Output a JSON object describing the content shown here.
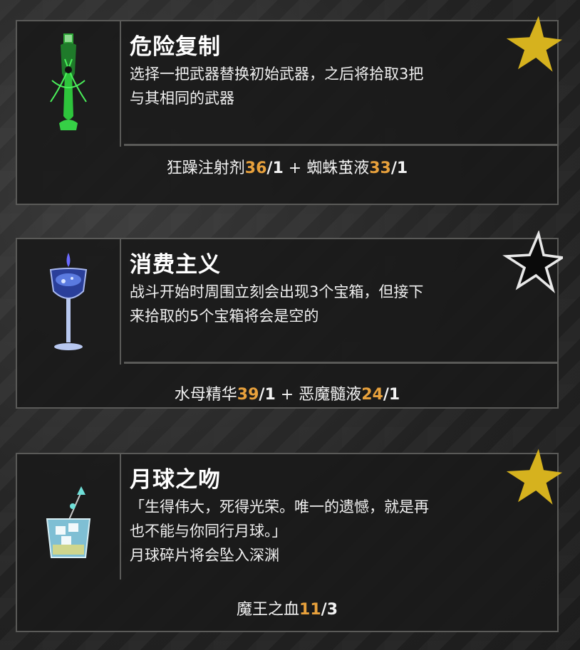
{
  "cards": [
    {
      "title": "危险复制",
      "desc": [
        "选择一把武器替换初始武器，之后将拾取3把",
        "与其相同的武器"
      ],
      "star": "gold-star",
      "recipe": [
        {
          "name": "狂躁注射剂",
          "have": "36",
          "need": "1"
        },
        {
          "sep": " + "
        },
        {
          "name": "蜘蛛茧液",
          "have": "33",
          "need": "1"
        }
      ],
      "icon": "green-potion-vial-icon"
    },
    {
      "title": "消费主义",
      "desc": [
        "战斗开始时周围立刻会出现3个宝箱，但接下",
        "来拾取的5个宝箱将会是空的"
      ],
      "star": "black-star",
      "recipe": [
        {
          "name": "水母精华",
          "have": "39",
          "need": "1"
        },
        {
          "sep": " + "
        },
        {
          "name": "恶魔髓液",
          "have": "24",
          "need": "1"
        }
      ],
      "icon": "blue-cocktail-glass-icon"
    },
    {
      "title": "月球之吻",
      "desc": [
        "「生得伟大，死得光荣。唯一的遗憾，就是再",
        "也不能与你同行月球。」",
        "月球碎片将会坠入深渊"
      ],
      "star": "gold-star",
      "recipe": [
        {
          "name": "魔王之血",
          "have": "11",
          "need": "3"
        }
      ],
      "icon": "ice-whiskey-glass-icon"
    }
  ],
  "colors": {
    "accent": "#e8a13c",
    "gold_star": "#d6b21e",
    "border": "#5a5a58"
  }
}
